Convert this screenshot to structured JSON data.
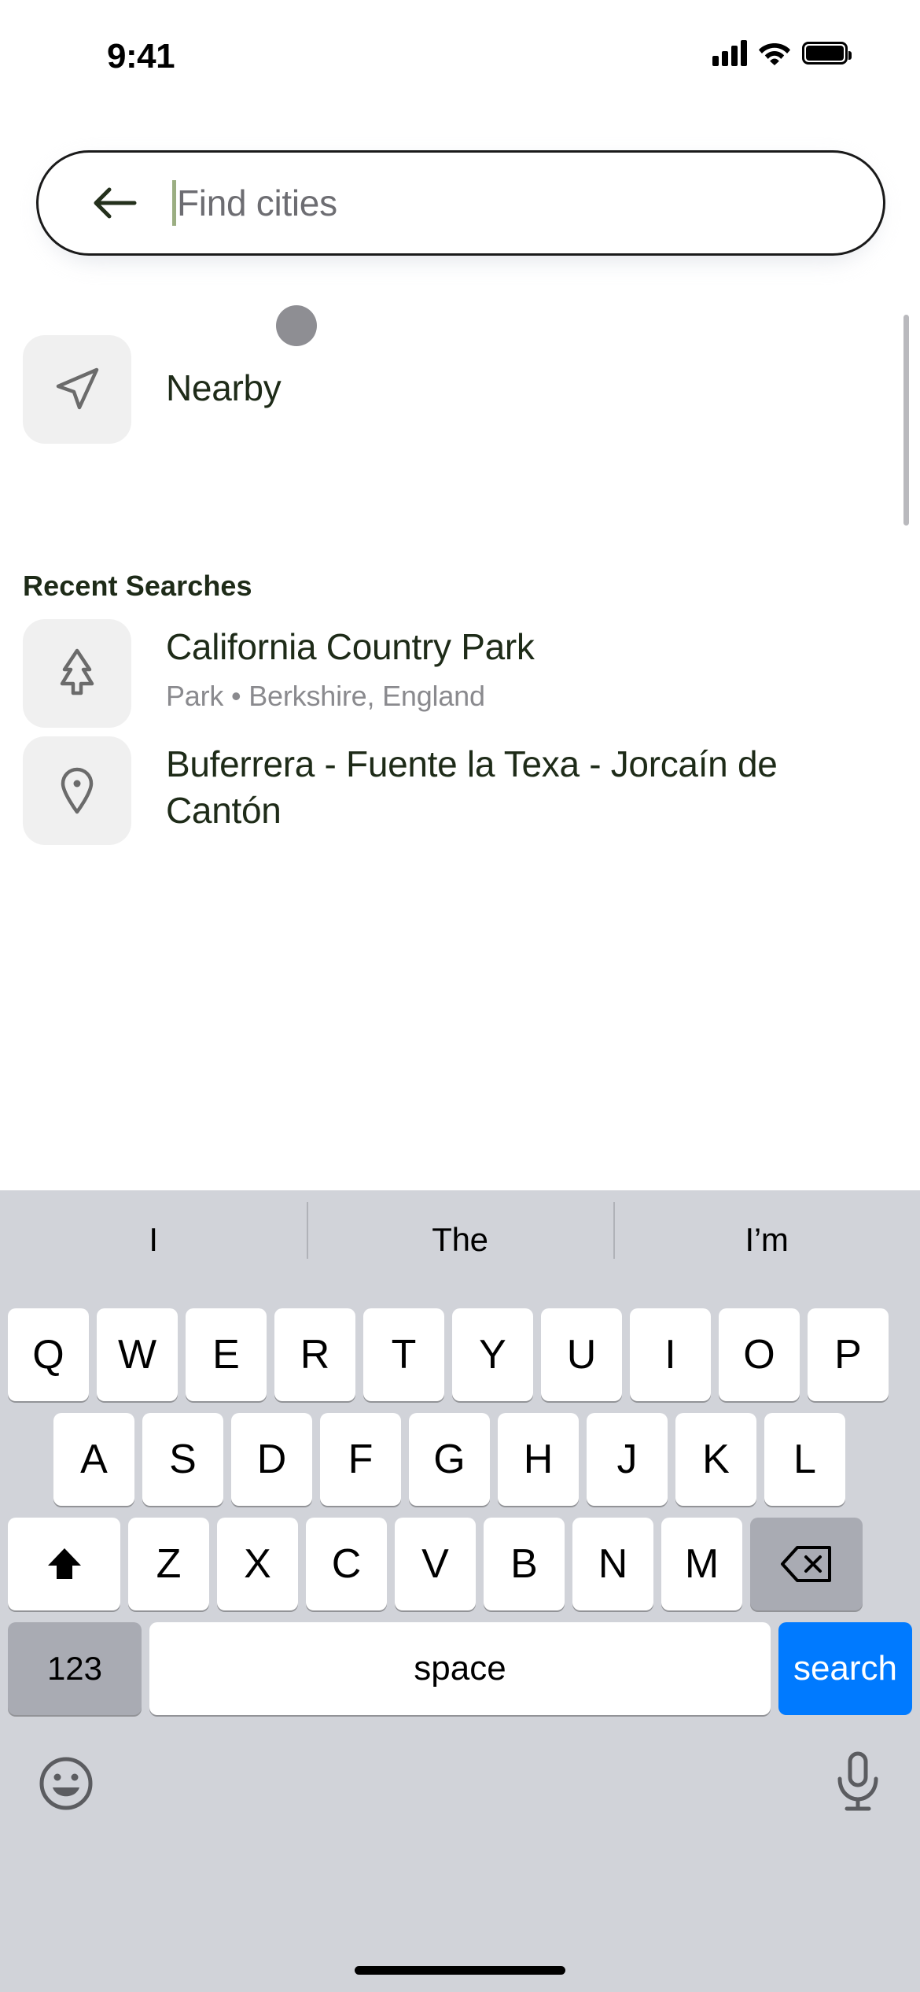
{
  "status_bar": {
    "time": "9:41",
    "signal_icon": "cellular-signal-icon",
    "wifi_icon": "wifi-icon",
    "battery_icon": "battery-icon"
  },
  "search": {
    "back_icon": "back-arrow-icon",
    "placeholder": "Find cities",
    "value": "",
    "caret_color": "#9bae82"
  },
  "nearby": {
    "icon": "navigation-arrow-icon",
    "label": "Nearby"
  },
  "recent": {
    "section_title": "Recent Searches",
    "items": [
      {
        "icon": "tree-icon",
        "title": "California Country Park",
        "subtitle": "Park • Berkshire, England"
      },
      {
        "icon": "map-pin-icon",
        "title": "Buferrera - Fuente la Texa - Jorcaín de Cantón",
        "subtitle": ""
      }
    ]
  },
  "keyboard": {
    "suggestions": [
      "I",
      "The",
      "I’m"
    ],
    "row1": [
      "Q",
      "W",
      "E",
      "R",
      "T",
      "Y",
      "U",
      "I",
      "O",
      "P"
    ],
    "row2": [
      "A",
      "S",
      "D",
      "F",
      "G",
      "H",
      "J",
      "K",
      "L"
    ],
    "row3_letters": [
      "Z",
      "X",
      "C",
      "V",
      "B",
      "N",
      "M"
    ],
    "shift_icon": "shift-arrow-icon",
    "backspace_icon": "backspace-icon",
    "numbers_label": "123",
    "space_label": "space",
    "return_label": "search",
    "emoji_icon": "emoji-smiley-icon",
    "mic_icon": "microphone-icon",
    "return_color": "#007aff"
  }
}
